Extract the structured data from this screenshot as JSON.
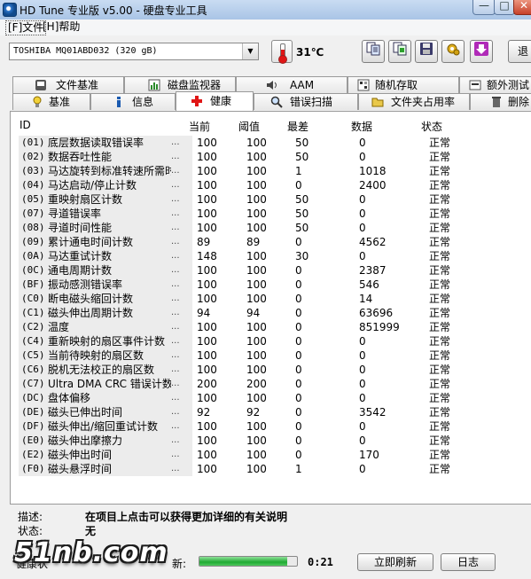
{
  "window": {
    "title": "HD Tune 专业版 v5.00 - 硬盘专业工具",
    "min": "—",
    "max": "□",
    "close": "✕"
  },
  "menu": {
    "file": "[F]文件",
    "help": "[H]帮助"
  },
  "toolbar": {
    "drive": "TOSHIBA MQ01ABD032 (320 gB)",
    "temperature": "31℃",
    "exit": "退"
  },
  "tabs_row1": [
    {
      "label": "文件基准",
      "icon": "file-benchmark-icon"
    },
    {
      "label": "磁盘监视器",
      "icon": "disk-monitor-icon"
    },
    {
      "label": "AAM",
      "icon": "aam-icon"
    },
    {
      "label": "随机存取",
      "icon": "random-access-icon"
    },
    {
      "label": "额外测试",
      "icon": "extra-tests-icon"
    }
  ],
  "tabs_row2": [
    {
      "label": "基准",
      "icon": "benchmark-icon"
    },
    {
      "label": "信息",
      "icon": "info-icon"
    },
    {
      "label": "健康",
      "icon": "health-icon",
      "active": true
    },
    {
      "label": "错误扫描",
      "icon": "error-scan-icon"
    },
    {
      "label": "文件夹占用率",
      "icon": "folder-usage-icon"
    },
    {
      "label": "删除",
      "icon": "erase-icon"
    }
  ],
  "table": {
    "headers": {
      "id": "ID",
      "current": "当前",
      "threshold": "阈值",
      "worst": "最差",
      "data": "数据",
      "status": "状态"
    },
    "rows": [
      {
        "id": "(01)",
        "name": "底层数据读取错误率",
        "cur": "100",
        "thr": "100",
        "worst": "50",
        "data": "0",
        "status": "正常"
      },
      {
        "id": "(02)",
        "name": "数据吞吐性能",
        "cur": "100",
        "thr": "100",
        "worst": "50",
        "data": "0",
        "status": "正常"
      },
      {
        "id": "(03)",
        "name": "马达旋转到标准转速所需时间",
        "cur": "100",
        "thr": "100",
        "worst": "1",
        "data": "1018",
        "status": "正常"
      },
      {
        "id": "(04)",
        "name": "马达启动/停止计数",
        "cur": "100",
        "thr": "100",
        "worst": "0",
        "data": "2400",
        "status": "正常"
      },
      {
        "id": "(05)",
        "name": "重映射扇区计数",
        "cur": "100",
        "thr": "100",
        "worst": "50",
        "data": "0",
        "status": "正常"
      },
      {
        "id": "(07)",
        "name": "寻道错误率",
        "cur": "100",
        "thr": "100",
        "worst": "50",
        "data": "0",
        "status": "正常"
      },
      {
        "id": "(08)",
        "name": "寻道时间性能",
        "cur": "100",
        "thr": "100",
        "worst": "50",
        "data": "0",
        "status": "正常"
      },
      {
        "id": "(09)",
        "name": "累计通电时间计数",
        "cur": "89",
        "thr": "89",
        "worst": "0",
        "data": "4562",
        "status": "正常"
      },
      {
        "id": "(0A)",
        "name": "马达重试计数",
        "cur": "148",
        "thr": "100",
        "worst": "30",
        "data": "0",
        "status": "正常"
      },
      {
        "id": "(0C)",
        "name": "通电周期计数",
        "cur": "100",
        "thr": "100",
        "worst": "0",
        "data": "2387",
        "status": "正常"
      },
      {
        "id": "(BF)",
        "name": "振动感测错误率",
        "cur": "100",
        "thr": "100",
        "worst": "0",
        "data": "546",
        "status": "正常"
      },
      {
        "id": "(C0)",
        "name": "断电磁头缩回计数",
        "cur": "100",
        "thr": "100",
        "worst": "0",
        "data": "14",
        "status": "正常"
      },
      {
        "id": "(C1)",
        "name": "磁头伸出周期计数",
        "cur": "94",
        "thr": "94",
        "worst": "0",
        "data": "63696",
        "status": "正常"
      },
      {
        "id": "(C2)",
        "name": "温度",
        "cur": "100",
        "thr": "100",
        "worst": "0",
        "data": "851999",
        "status": "正常"
      },
      {
        "id": "(C4)",
        "name": "重新映射的扇区事件计数",
        "cur": "100",
        "thr": "100",
        "worst": "0",
        "data": "0",
        "status": "正常"
      },
      {
        "id": "(C5)",
        "name": "当前待映射的扇区数",
        "cur": "100",
        "thr": "100",
        "worst": "0",
        "data": "0",
        "status": "正常"
      },
      {
        "id": "(C6)",
        "name": "脱机无法校正的扇区数",
        "cur": "100",
        "thr": "100",
        "worst": "0",
        "data": "0",
        "status": "正常"
      },
      {
        "id": "(C7)",
        "name": "Ultra DMA CRC 错误计数",
        "cur": "200",
        "thr": "200",
        "worst": "0",
        "data": "0",
        "status": "正常"
      },
      {
        "id": "(DC)",
        "name": "盘体偏移",
        "cur": "100",
        "thr": "100",
        "worst": "0",
        "data": "0",
        "status": "正常"
      },
      {
        "id": "(DE)",
        "name": "磁头已伸出时间",
        "cur": "92",
        "thr": "92",
        "worst": "0",
        "data": "3542",
        "status": "正常"
      },
      {
        "id": "(DF)",
        "name": "磁头伸出/缩回重试计数",
        "cur": "100",
        "thr": "100",
        "worst": "0",
        "data": "0",
        "status": "正常"
      },
      {
        "id": "(E0)",
        "name": "磁头伸出摩擦力",
        "cur": "100",
        "thr": "100",
        "worst": "0",
        "data": "0",
        "status": "正常"
      },
      {
        "id": "(E2)",
        "name": "磁头伸出时间",
        "cur": "100",
        "thr": "100",
        "worst": "0",
        "data": "170",
        "status": "正常"
      },
      {
        "id": "(F0)",
        "name": "磁头悬浮时间",
        "cur": "100",
        "thr": "100",
        "worst": "1",
        "data": "0",
        "status": "正常"
      }
    ],
    "ellipsis": "..."
  },
  "info": {
    "desc_label": "描述:",
    "desc_value": "在项目上点击可以获得更加详细的有关说明",
    "status_label": "状态:",
    "status_value": "无"
  },
  "bottom": {
    "label_left": "健康状",
    "label_right": "新:",
    "progress_fraction": 0.9,
    "time": "0:21",
    "refresh_button": "立即刷新",
    "log_button": "日志"
  },
  "watermark": "51nb.com"
}
